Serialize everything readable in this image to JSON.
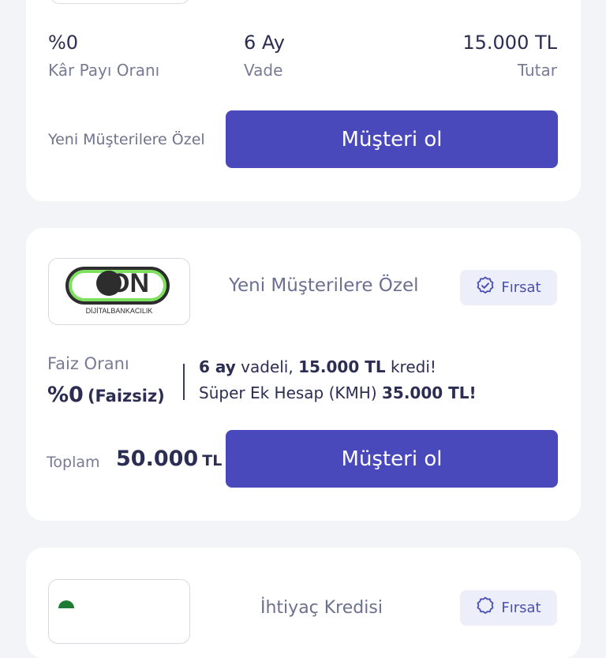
{
  "card1": {
    "stats": [
      {
        "value": "%0",
        "label": "Kâr Payı Oranı"
      },
      {
        "value": "6 Ay",
        "label": "Vade"
      },
      {
        "value": "15.000 TL",
        "label": "Tutar"
      }
    ],
    "special_text": "Yeni Müşterilere Özel",
    "cta_label": "Müşteri ol"
  },
  "card2": {
    "logo": {
      "main": "ON",
      "caption": "DİJİTALBANKACILIK"
    },
    "special_text": "Yeni Müşterilere Özel",
    "badge": {
      "icon": "verified-badge-icon",
      "label": "Fırsat"
    },
    "rate": {
      "label": "Faiz Oranı",
      "value": "%0",
      "qualifier": "(Faizsiz)"
    },
    "description": {
      "line1": {
        "term": "6 ay",
        "term_suffix": " vadeli, ",
        "amount": "15.000 TL",
        "amount_suffix": " kredi!"
      },
      "line2": {
        "prefix": "Süper Ek Hesap (KMH) ",
        "amount": "35.000 TL!"
      }
    },
    "total": {
      "label": "Toplam",
      "value": "50.000",
      "currency": "TL"
    },
    "cta_label": "Müşteri ol"
  },
  "card3": {
    "title": "İhtiyaç Kredisi",
    "badge": {
      "icon": "verified-badge-icon",
      "label": "Fırsat"
    }
  },
  "colors": {
    "accent": "#4949bb",
    "badge_bg": "#eceef9",
    "logo_green": "#7de05e",
    "text_dark": "#2b2d52",
    "text_muted": "#777b95",
    "page_bg": "#f3f4f8"
  }
}
